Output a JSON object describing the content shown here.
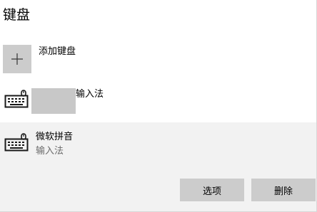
{
  "page": {
    "title": "键盘"
  },
  "add_keyboard": {
    "label": "添加键盘",
    "icon": "plus-icon"
  },
  "keyboards": [
    {
      "icon": "keyboard-icon",
      "sublabel": "输入法"
    }
  ],
  "ime": {
    "icon": "keyboard-icon",
    "name": "微软拼音",
    "type": "输入法",
    "options_label": "选项",
    "delete_label": "删除"
  },
  "colors": {
    "tile": "#cccccc",
    "selected_background": "#f2f2f2",
    "secondary_text": "#6b6b6b"
  }
}
